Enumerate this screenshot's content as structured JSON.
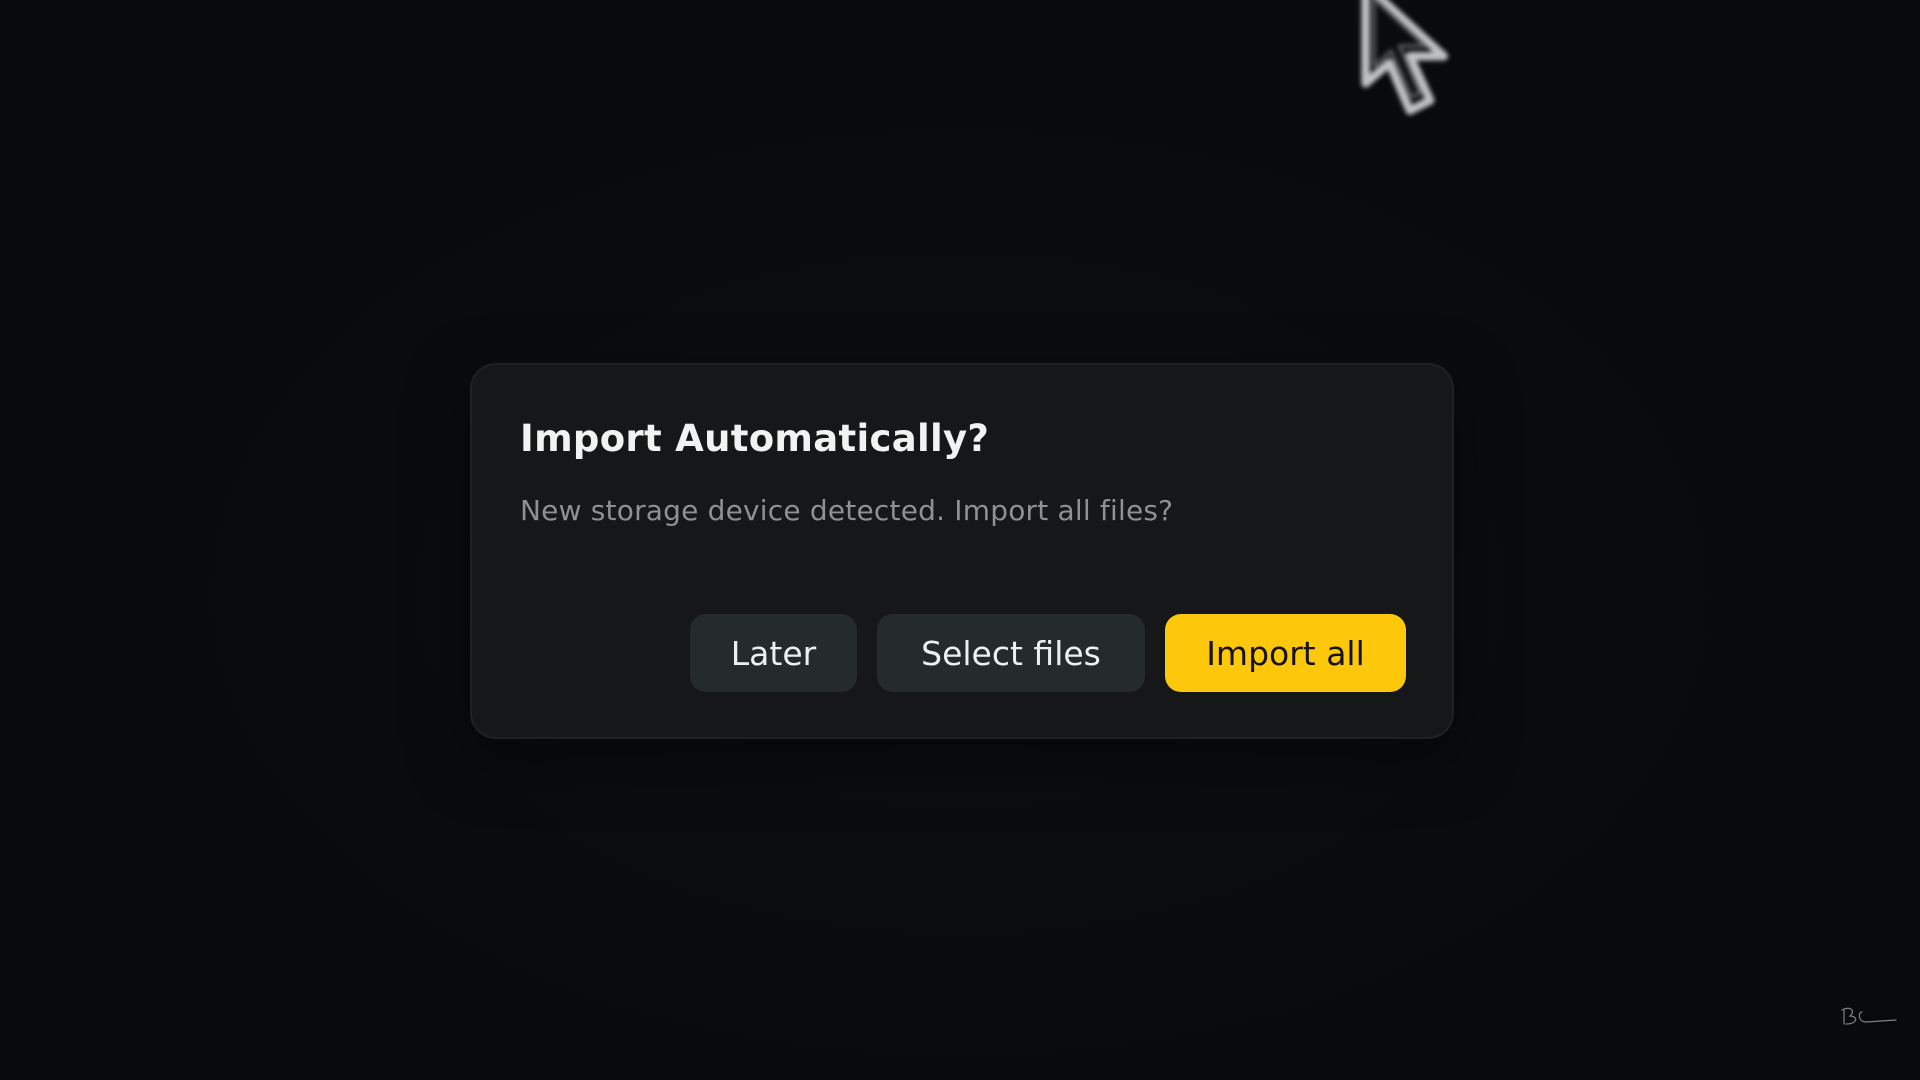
{
  "dialog": {
    "title": "Import Automatically?",
    "message": "New storage device detected. Import all files?",
    "buttons": {
      "later": "Later",
      "select_files": "Select files",
      "import_all": "Import all"
    }
  },
  "colors": {
    "background": "#080b0e",
    "dialog_bg": "#151718",
    "secondary_button": "#252a2c",
    "accent": "#fdc70c"
  },
  "overlay": {
    "cursor_icon": "pointer-cursor-icon",
    "signature_text": "BC"
  }
}
